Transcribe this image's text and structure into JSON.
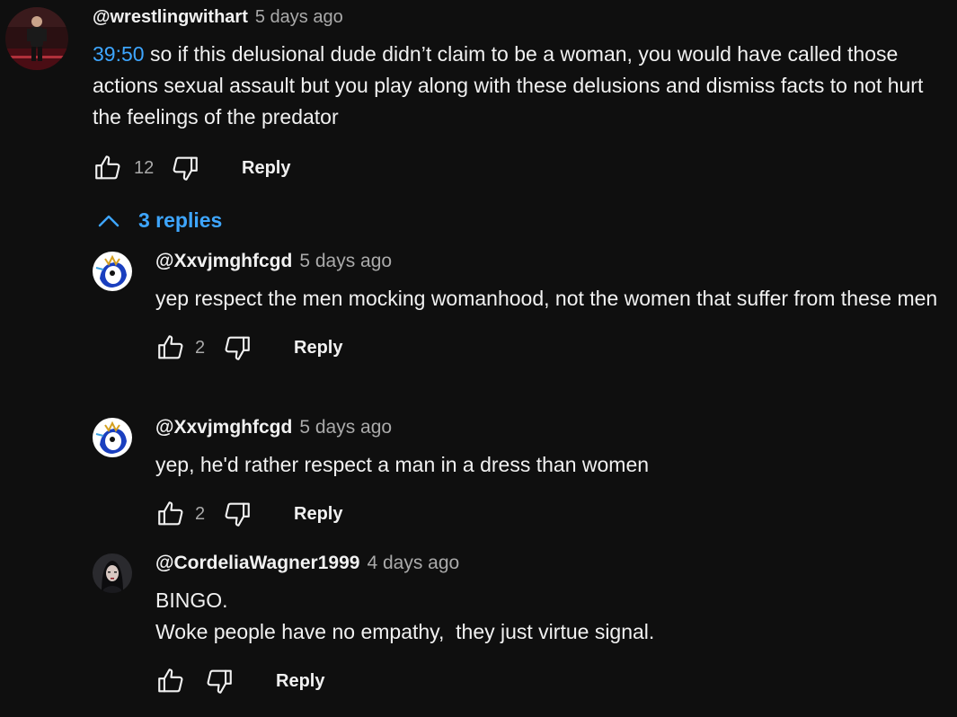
{
  "comment": {
    "author": "@wrestlingwithart",
    "time": "5 days ago",
    "timestamp_link": "39:50",
    "text": " so if this delusional dude didn’t claim to be a woman, you would have called those actions sexual assault but you play along with these delusions and dismiss facts to not hurt the feelings of the predator",
    "likes": "12",
    "reply_label": "Reply"
  },
  "replies_toggle": {
    "label": "3 replies",
    "icon": "chevron-up-icon"
  },
  "replies": [
    {
      "author": "@Xxvjmghfcgd",
      "time": "5 days ago",
      "text": "yep respect the men mocking womanhood, not the women that suffer from these men",
      "likes": "2",
      "reply_label": "Reply"
    },
    {
      "author": "@Xxvjmghfcgd",
      "time": "5 days ago",
      "text": "yep, he'd rather respect a man in a dress than women",
      "likes": "2",
      "reply_label": "Reply"
    },
    {
      "author": "@CordeliaWagner1999",
      "time": "4 days ago",
      "lines": [
        "BINGO.",
        "Woke people have no empathy,  they just virtue signal."
      ],
      "likes": "",
      "reply_label": "Reply"
    }
  ],
  "colors": {
    "background": "#0f0f0f",
    "text": "#f1f1f1",
    "secondary_text": "#aaaaaa",
    "link": "#3ea6ff"
  }
}
